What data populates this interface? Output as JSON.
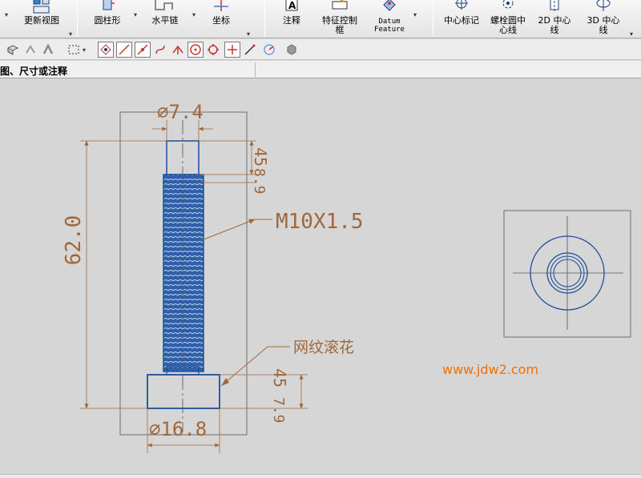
{
  "ribbon": {
    "update_views": "更新视图",
    "cylinder": "圆柱形",
    "horizontal_chain": "水平链",
    "coordinate": "坐标",
    "annotation": "注释",
    "feature_control_frame": "特征控制\n框",
    "datum_feature": "Datum\nFeature",
    "center_mark": "中心标记",
    "bolt_circle_centerline": "螺栓圆中\n心线",
    "centerline_2d": "2D 中心\n线",
    "centerline_3d": "3D 中心\n线"
  },
  "toolbar3": {
    "hint": "图、尺寸或注释"
  },
  "drawing": {
    "top_diameter": "∅7.4",
    "thread_length_small": "45",
    "thread_offset": "8.9",
    "overall_length": "62.0",
    "thread_callout": "M10X1.5",
    "knurl_callout": "网纹滚花",
    "head_height_small": "45",
    "head_height": "7.9",
    "head_diameter": "∅16.8"
  },
  "watermark": {
    "url": "www.jdw2.com"
  },
  "colors": {
    "dimension": "#a0683a",
    "geometry": "#1f4e9a",
    "watermark": "#f07000",
    "canvas": "#d6d6d6"
  }
}
